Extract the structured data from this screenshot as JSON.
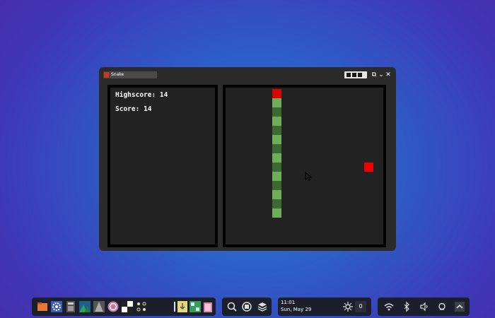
{
  "window": {
    "title": "Snake",
    "buttons": {
      "restore": "⧉",
      "minimize": "⌄",
      "close": "✕"
    }
  },
  "scores": {
    "highscore": "Highscore: 14",
    "score": "Score: 14"
  },
  "game": {
    "food_color": "#ee0000",
    "head_color": "#dd0000",
    "body_light": "#6fad58",
    "body_dark": "#3a6a30"
  },
  "taskbar": {
    "apps": [
      "files-icon",
      "settings-icon",
      "calculator-icon",
      "image-viewer-icon",
      "inkscape-icon",
      "browser-icon",
      "chess-icon",
      "tiles-icon",
      "document-viewer-icon",
      "installer-icon",
      "spreadsheet-icon",
      "trash-icon"
    ],
    "search": [
      "search-icon",
      "screenshot-icon",
      "layers-icon"
    ],
    "clock": {
      "time": "11:01",
      "date": "Sun, May 29"
    },
    "notifications": "0",
    "tray": [
      "wifi-icon",
      "bluetooth-icon",
      "volume-icon",
      "notification-icon",
      "expand-icon"
    ]
  }
}
